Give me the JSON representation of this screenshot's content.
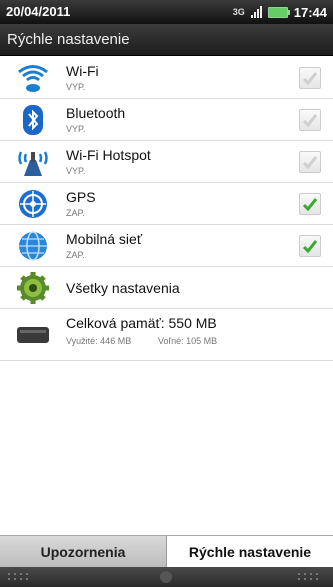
{
  "status_bar": {
    "date": "20/04/2011",
    "network": "3G",
    "time": "17:44"
  },
  "header": {
    "title": "Rýchle nastavenie"
  },
  "settings": [
    {
      "title": "Wi-Fi",
      "state": "VYP.",
      "checked": false
    },
    {
      "title": "Bluetooth",
      "state": "VYP.",
      "checked": false
    },
    {
      "title": "Wi-Fi Hotspot",
      "state": "VYP.",
      "checked": false
    },
    {
      "title": "GPS",
      "state": "ZAP.",
      "checked": true
    },
    {
      "title": "Mobilná sieť",
      "state": "ZAP.",
      "checked": true
    }
  ],
  "all_settings": {
    "title": "Všetky nastavenia"
  },
  "storage": {
    "title": "Celková pamäť: 550 MB",
    "used": "Využité: 446 MB",
    "free": "Voľné: 105 MB"
  },
  "tabs": {
    "notifications": "Upozornenia",
    "quick_settings": "Rýchle nastavenie"
  },
  "colors": {
    "check_green": "#3aa82f",
    "header_bg": "#2a2a2a"
  }
}
